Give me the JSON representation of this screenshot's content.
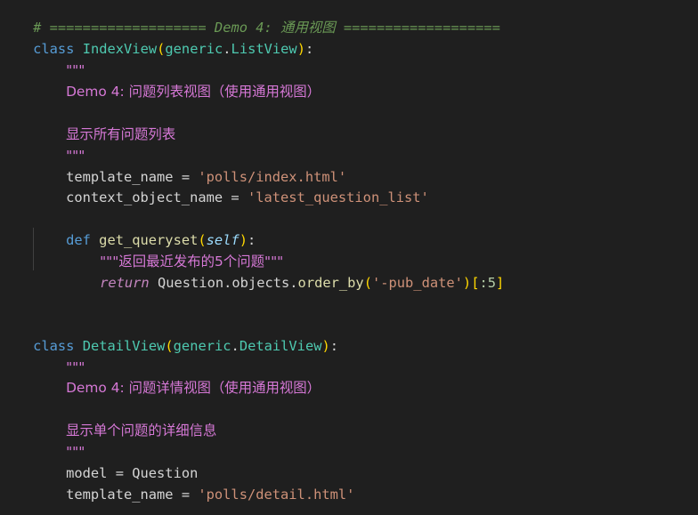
{
  "colors": {
    "background": "#1f1f1f",
    "comment": "#6a9955",
    "keyword": "#569cd6",
    "class_name": "#4ec9b0",
    "function": "#dcdcaa",
    "string": "#ce9178",
    "docstring": "#d678d6",
    "bracket_gold": "#ffd700",
    "bracket_purple": "#da70d6"
  },
  "code": {
    "comment_line": "# =================== Demo 4: 通用视图 ===================",
    "index_view": {
      "kw_class": "class",
      "name": "IndexView",
      "paren_open": "(",
      "base_module": "generic",
      "dot": ".",
      "base_class": "ListView",
      "paren_close": ")",
      "colon": ":",
      "doc_open": "\"\"\"",
      "doc_line1": "Demo 4: 问题列表视图（使用通用视图）",
      "doc_line2": "显示所有问题列表",
      "doc_close": "\"\"\"",
      "attr1_name": "template_name",
      "attr1_eq": " = ",
      "attr1_value": "'polls/index.html'",
      "attr2_name": "context_object_name",
      "attr2_eq": " = ",
      "attr2_value": "'latest_question_list'",
      "def_kw": "def",
      "method_name": "get_queryset",
      "method_paren_open": "(",
      "method_param": "self",
      "method_paren_close": ")",
      "method_colon": ":",
      "method_doc": "\"\"\"返回最近发布的5个问题\"\"\"",
      "return_kw": "return",
      "return_obj": "Question",
      "return_dot1": ".",
      "return_attr": "objects",
      "return_dot2": ".",
      "return_func": "order_by",
      "return_paren_open": "(",
      "return_arg": "'-pub_date'",
      "return_paren_close": ")",
      "return_slice_open": "[",
      "return_slice": ":5",
      "return_slice_close": "]"
    },
    "detail_view": {
      "kw_class": "class",
      "name": "DetailView",
      "paren_open": "(",
      "base_module": "generic",
      "dot": ".",
      "base_class": "DetailView",
      "paren_close": ")",
      "colon": ":",
      "doc_open": "\"\"\"",
      "doc_line1": "Demo 4: 问题详情视图（使用通用视图）",
      "doc_line2": "显示单个问题的详细信息",
      "doc_close": "\"\"\"",
      "attr1_name": "model",
      "attr1_eq": " = ",
      "attr1_value": "Question",
      "attr2_name": "template_name",
      "attr2_eq": " = ",
      "attr2_value": "'polls/detail.html'"
    }
  }
}
